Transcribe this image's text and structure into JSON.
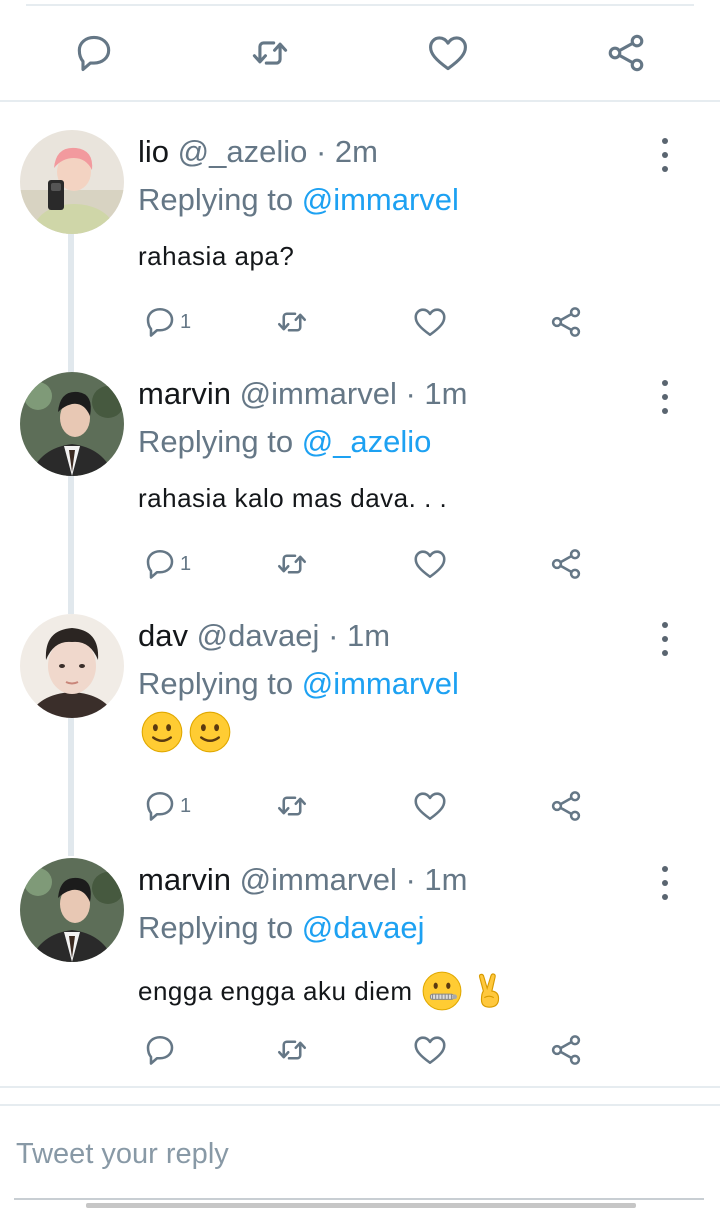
{
  "tweet_actions": [
    "reply-icon",
    "retweet-icon",
    "like-icon",
    "share-icon"
  ],
  "colors": {
    "mention": "#1da1f2",
    "secondary_text": "#657786",
    "icon": "#657786",
    "thread_line": "#e1e8ed"
  },
  "replies": [
    {
      "name": "lio",
      "handle": "@_azelio",
      "time": "· 2m",
      "replying_prefix": "Replying to",
      "replying_to": "@immarvel",
      "text": "rahasia apa?",
      "reply_count": "1"
    },
    {
      "name": "marvin",
      "handle": "@immarvel",
      "time": "· 1m",
      "replying_prefix": "Replying to",
      "replying_to": "@_azelio",
      "text": "rahasia kalo mas dava. . .",
      "reply_count": "1"
    },
    {
      "name": "dav",
      "handle": "@davaej",
      "time": "· 1m",
      "replying_prefix": "Replying to",
      "replying_to": "@immarvel",
      "text": "",
      "emoji": [
        "slightly-smiling-face",
        "slightly-smiling-face"
      ],
      "reply_count": "1"
    },
    {
      "name": "marvin",
      "handle": "@immarvel",
      "time": "· 1m",
      "replying_prefix": "Replying to",
      "replying_to": "@davaej",
      "text": "engga engga aku diem",
      "emoji": [
        "zipper-mouth-face",
        "victory-hand"
      ],
      "reply_count": ""
    }
  ],
  "composer": {
    "placeholder": "Tweet your reply"
  }
}
